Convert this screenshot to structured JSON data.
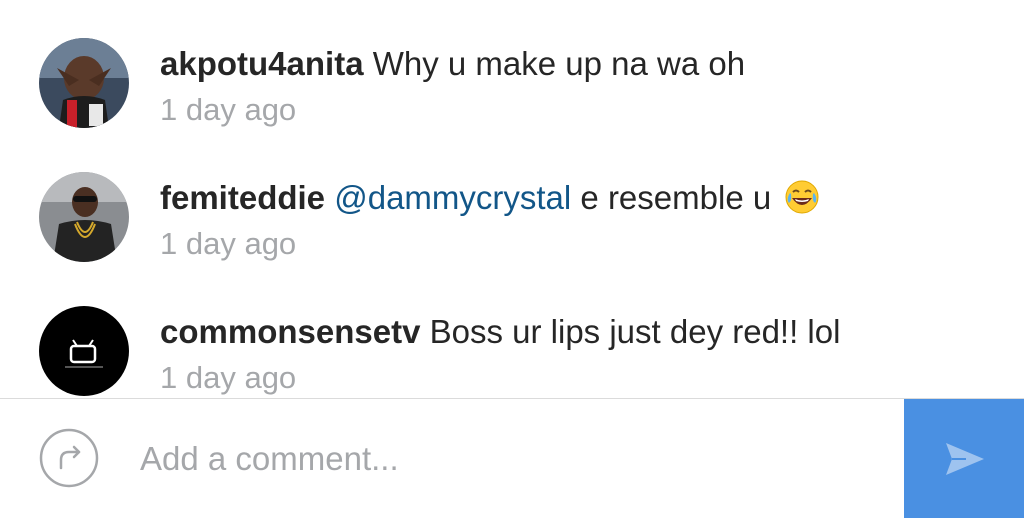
{
  "comments": [
    {
      "username": "akpotu4anita",
      "text": "Why u make up na wa  oh",
      "mention": "",
      "timestamp": "1 day ago",
      "avatar": "user-photo"
    },
    {
      "username": "femiteddie",
      "mention": "@dammycrystal",
      "text": "e resemble u",
      "emoji": "tears-of-joy-emoji",
      "timestamp": "1 day ago",
      "avatar": "user-photo"
    },
    {
      "username": "commonsensetv",
      "text": "Boss ur lips just dey red!! lol",
      "mention": "",
      "timestamp": "1 day ago",
      "avatar": "tv-logo"
    }
  ],
  "composer": {
    "placeholder": "Add a comment...",
    "share_icon": "share-arrow-icon",
    "send_icon": "send-icon"
  },
  "colors": {
    "text": "#262626",
    "mention": "#125688",
    "timestamp": "#a5a7aa",
    "send_button": "#4a90e2"
  }
}
